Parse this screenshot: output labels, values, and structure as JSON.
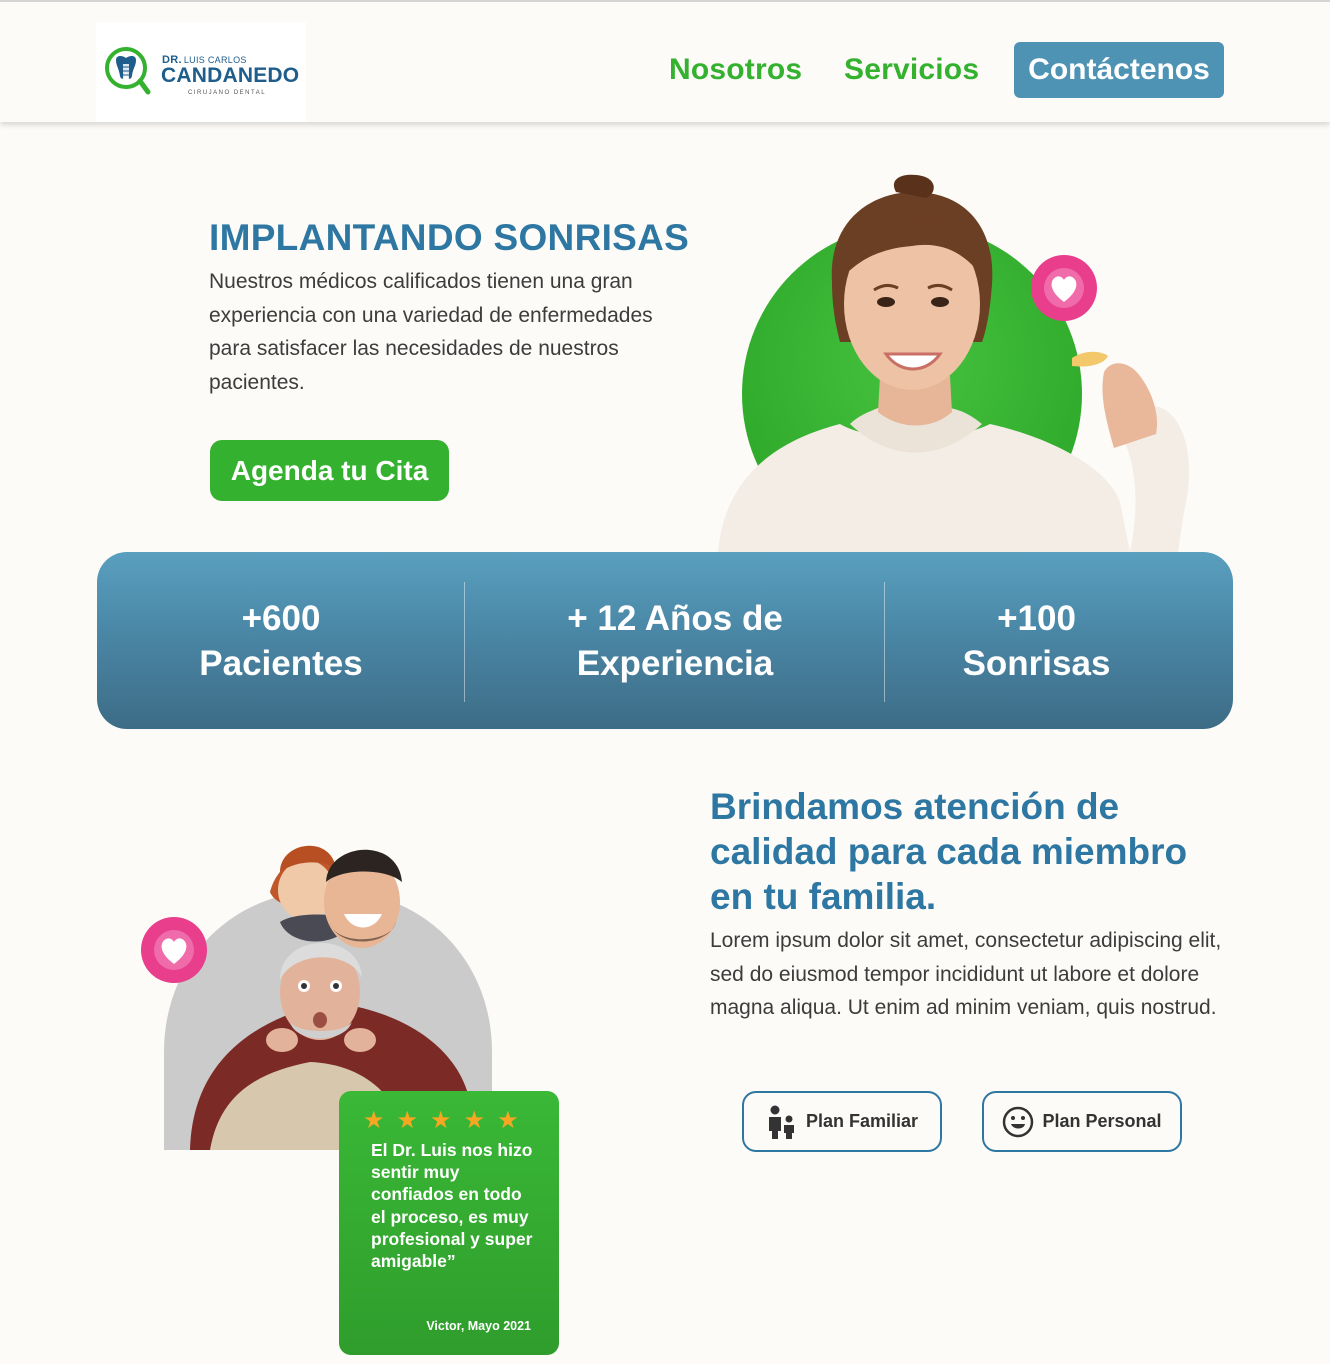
{
  "header": {
    "logo": {
      "prefix": "DR.",
      "first_names": "LUIS CARLOS",
      "surname": "CANDANEDO",
      "subtitle": "CIRUJANO DENTAL"
    },
    "nav": [
      {
        "label": "Nosotros"
      },
      {
        "label": "Servicios"
      }
    ],
    "cta_label": "Contáctenos"
  },
  "hero": {
    "title": "IMPLANTANDO SONRISAS",
    "text": "Nuestros médicos calificados tienen una gran experiencia con una variedad de enfermedades para satisfacer las necesidades de nuestros pacientes.",
    "button_label": "Agenda tu Cita"
  },
  "stats": [
    {
      "line1": "+600",
      "line2": "Pacientes"
    },
    {
      "line1": "+ 12 Años de",
      "line2": "Experiencia"
    },
    {
      "line1": "+100",
      "line2": "Sonrisas"
    }
  ],
  "family": {
    "title": "Brindamos atención de calidad para cada miembro en tu familia.",
    "text": "Lorem ipsum dolor sit amet, consectetur adipiscing elit, sed do eiusmod tempor incididunt ut labore et dolore magna aliqua. Ut enim ad minim veniam, quis nostrud.",
    "plans": [
      {
        "label": "Plan Familiar",
        "icon": "family-icon"
      },
      {
        "label": "Plan Personal",
        "icon": "smiley-icon"
      }
    ]
  },
  "testimonial": {
    "rating": 5,
    "quote": "El Dr. Luis nos hizo sentir muy confiados en todo el proceso, es muy profesional y super amigable”",
    "author": "Victor, Mayo 2021"
  },
  "colors": {
    "brand_green": "#34b12f",
    "brand_blue": "#2d77a2",
    "cta_blue": "#4e93b4",
    "heart_pink": "#e83e8c",
    "star": "#f6a623",
    "background": "#fcfbf8"
  }
}
